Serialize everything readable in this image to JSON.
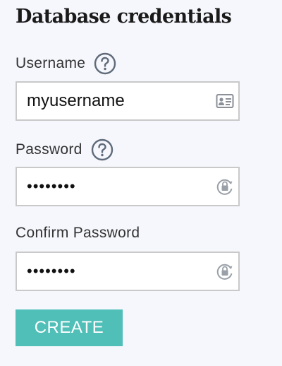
{
  "form": {
    "title": "Database credentials",
    "username": {
      "label": "Username",
      "value": "myusername",
      "help_icon": "question-circle-icon",
      "field_icon": "contact-card-icon"
    },
    "password": {
      "label": "Password",
      "value": "password",
      "help_icon": "question-circle-icon",
      "field_icon": "lock-rotate-icon"
    },
    "confirm_password": {
      "label": "Confirm Password",
      "value": "password",
      "field_icon": "lock-rotate-icon"
    },
    "create_label": "CREATE"
  },
  "colors": {
    "background": "#f6f7fc",
    "button": "#4fbfb8",
    "field_border": "#c9c9c9",
    "icon": "#6b7280"
  }
}
